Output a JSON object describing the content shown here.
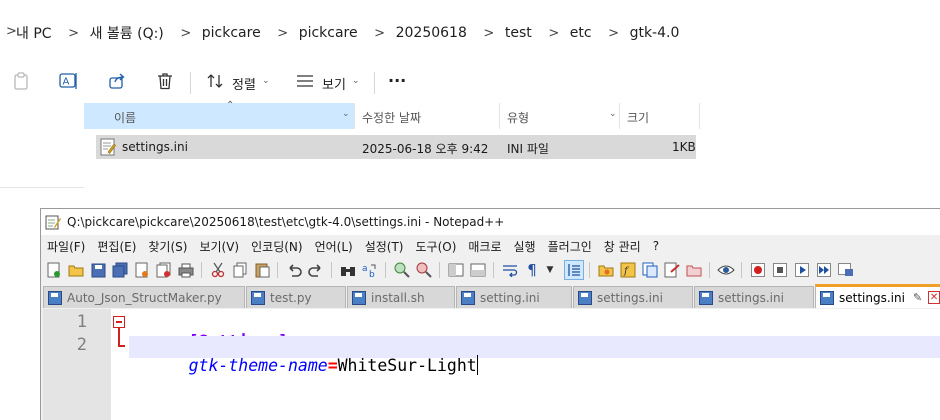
{
  "explorer": {
    "breadcrumb": [
      "내 PC",
      "새 볼륨 (Q:)",
      "pickcare",
      "pickcare",
      "20250618",
      "test",
      "etc",
      "gtk-4.0"
    ],
    "toolbar": {
      "sort_label": "정렬",
      "view_label": "보기",
      "more_label": "···"
    },
    "columns": {
      "name": "이름",
      "modified": "수정한 날짜",
      "type": "유형",
      "size": "크기"
    },
    "files": [
      {
        "name": "settings.ini",
        "modified": "2025-06-18 오후 9:42",
        "type": "INI 파일",
        "size": "1KB"
      }
    ]
  },
  "notepad": {
    "title": "Q:\\pickcare\\pickcare\\20250618\\test\\etc\\gtk-4.0\\settings.ini - Notepad++",
    "menu": [
      "파일(F)",
      "편집(E)",
      "찾기(S)",
      "보기(V)",
      "인코딩(N)",
      "언어(L)",
      "설정(T)",
      "도구(O)",
      "매크로",
      "실행",
      "플러그인",
      "창 관리",
      "?"
    ],
    "tabs": [
      "Auto_Json_StructMaker.py",
      "test.py",
      "install.sh",
      "setting.ini",
      "settings.ini",
      "settings.ini",
      "settings.ini"
    ],
    "active_tab": 6,
    "lines": [
      {
        "num": "1",
        "section": "[Settings]"
      },
      {
        "num": "2",
        "key": "gtk-theme-name",
        "eq": "=",
        "value": "WhiteSur-Light"
      }
    ]
  },
  "colors": {
    "selection": "#cde8ff",
    "row_selected": "#d9d9d9",
    "section": "#8000ff",
    "key": "#0000ff",
    "equals": "#ff0000",
    "active_tab_accent": "#f0a028"
  }
}
